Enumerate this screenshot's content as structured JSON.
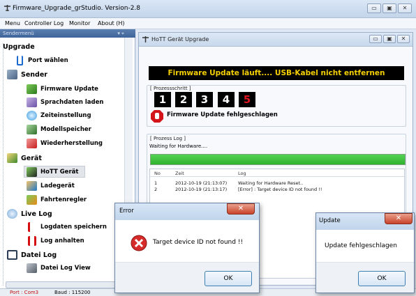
{
  "window": {
    "title": "Firmware_Upgrade_grStudio.  Version-2.8",
    "minimize": "▭",
    "maximize": "▣",
    "close": "✕"
  },
  "menu": [
    "Menu",
    "Controller Log",
    "Monitor",
    "About (H)"
  ],
  "sidebar": {
    "header": "Sendermenü",
    "pin": "▾ ⌖",
    "categories": {
      "upgrade": "Upgrade",
      "sender": "Sender",
      "geraet": "Gerät",
      "livelog": "Live Log",
      "dateilog": "Datei Log"
    },
    "items": {
      "port": "Port wählen",
      "firmware": "Firmware Update",
      "sprachdaten": "Sprachdaten laden",
      "zeit": "Zeiteinstellung",
      "modell": "Modellspeicher",
      "wieder": "Wiederherstellung",
      "hott": "HoTT Gerät",
      "lade": "Ladegerät",
      "fahrt": "Fahrtenregler",
      "logspeichern": "Logdaten speichern",
      "loganhalten": "Log anhalten",
      "dateiview": "Datei Log View"
    }
  },
  "status": {
    "port": "Port : Com3",
    "baud": "Baud : 115200"
  },
  "child": {
    "title": "HoTT Gerät Upgrade",
    "banner": "Firmware Update läuft.... USB-Kabel nicht entfernen",
    "prozess_label": "[ Prozessschritt ]",
    "steps": [
      "1",
      "2",
      "3",
      "4",
      "5"
    ],
    "failed_text": "Firmware Update fehlgeschlagen",
    "log_label": "[ Prozess Log ]",
    "waiting_text": "Waiting for Hardware....",
    "progress": 1.0,
    "table": {
      "headers": [
        "No",
        "Zeit",
        "Log"
      ],
      "rows": [
        [
          "1",
          "2012-10-19 (21:13:07)",
          "Waiting for Hardware Reset.."
        ],
        [
          "2",
          "2012-10-19 (21:13:17)",
          "[Error] : Target device ID not found !!"
        ]
      ]
    }
  },
  "error_dialog": {
    "title": "Error",
    "message": "Target device ID not found !!",
    "ok": "OK",
    "close": "✕"
  },
  "update_dialog": {
    "title": "Update",
    "message": "Update fehlgeschlagen",
    "ok": "OK",
    "close": "✕"
  },
  "colors": {
    "accent_green": "#2fb32f",
    "step_fail": "#e0141e",
    "banner_text": "#f5d000"
  }
}
